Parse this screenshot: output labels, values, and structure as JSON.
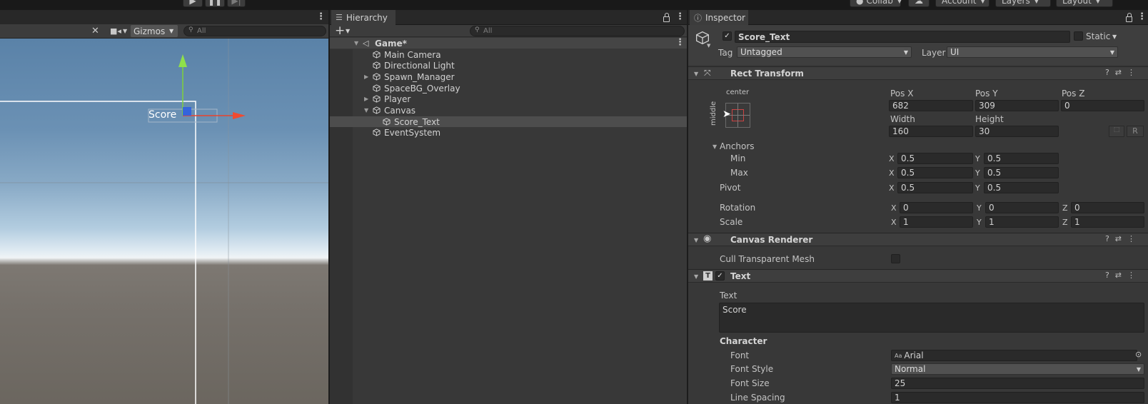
{
  "toolbar": {
    "play_icon": "play-icon",
    "pause_icon": "pause-icon",
    "step_icon": "step-icon",
    "collab_label": "Collab",
    "cloud_icon": "cloud-icon",
    "account_label": "Account",
    "layers_label": "Layers",
    "layout_label": "Layout"
  },
  "scene": {
    "gizmos_label": "Gizmos",
    "search_placeholder": "All",
    "score_object_label": "Score"
  },
  "hierarchy": {
    "tab_label": "Hierarchy",
    "search_placeholder": "All",
    "scene_name": "Game*",
    "items": [
      {
        "label": "Main Camera"
      },
      {
        "label": "Directional Light"
      },
      {
        "label": "Spawn_Manager"
      },
      {
        "label": "SpaceBG_Overlay"
      },
      {
        "label": "Player"
      },
      {
        "label": "Canvas"
      },
      {
        "label": "Score_Text"
      },
      {
        "label": "EventSystem"
      }
    ]
  },
  "inspector": {
    "tab_label": "Inspector",
    "object_name": "Score_Text",
    "static_label": "Static",
    "tag_label": "Tag",
    "tag_value": "Untagged",
    "layer_label": "Layer",
    "layer_value": "UI",
    "rect_transform": {
      "title": "Rect Transform",
      "anchor_h": "center",
      "anchor_v": "middle",
      "pos_x_label": "Pos X",
      "pos_x": "682",
      "pos_y_label": "Pos Y",
      "pos_y": "309",
      "pos_z_label": "Pos Z",
      "pos_z": "0",
      "width_label": "Width",
      "width": "160",
      "height_label": "Height",
      "height": "30",
      "r_button": "R",
      "anchors_label": "Anchors",
      "min_label": "Min",
      "min_x": "0.5",
      "min_y": "0.5",
      "max_label": "Max",
      "max_x": "0.5",
      "max_y": "0.5",
      "pivot_label": "Pivot",
      "pivot_x": "0.5",
      "pivot_y": "0.5",
      "rotation_label": "Rotation",
      "rot_x": "0",
      "rot_y": "0",
      "rot_z": "0",
      "scale_label": "Scale",
      "scale_x": "1",
      "scale_y": "1",
      "scale_z": "1",
      "x": "X",
      "y": "Y",
      "z": "Z"
    },
    "canvas_renderer": {
      "title": "Canvas Renderer",
      "cull_label": "Cull Transparent Mesh"
    },
    "text": {
      "title": "Text",
      "text_label": "Text",
      "text_value": "Score",
      "character_label": "Character",
      "font_label": "Font",
      "font_value": "Arial",
      "font_style_label": "Font Style",
      "font_style_value": "Normal",
      "font_size_label": "Font Size",
      "font_size_value": "25",
      "line_spacing_label": "Line Spacing",
      "line_spacing_value": "1"
    }
  }
}
